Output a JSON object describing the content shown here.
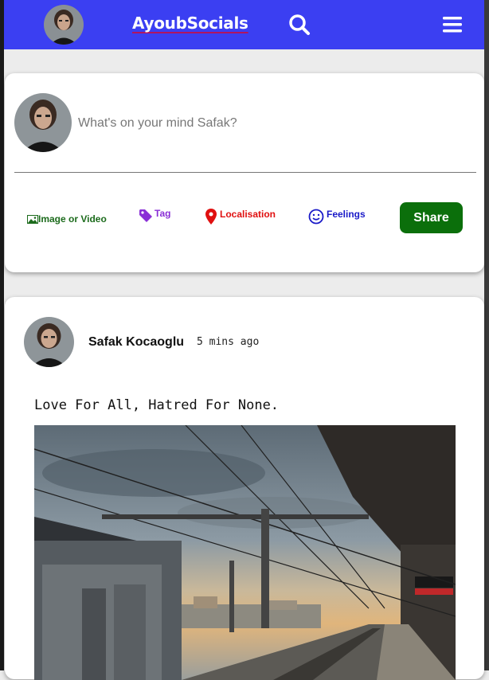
{
  "navbar": {
    "brand": "AyoubSocials",
    "icons": [
      "avatar",
      "search-icon",
      "menu-icon"
    ]
  },
  "composer": {
    "placeholder": "What's on your mind Safak?",
    "actions": {
      "image_video": "Image or Video",
      "tag": "Tag",
      "localisation": "Localisation",
      "feelings": "Feelings"
    },
    "share_label": "Share"
  },
  "post": {
    "author": "Safak Kocaoglu",
    "time": "5 mins ago",
    "text": "Love For All, Hatred For None."
  },
  "colors": {
    "navbar": "#3b3ff2",
    "share_button": "#0b6f0b",
    "image_action": "#1c6b1c",
    "tag_action": "#8a2fd6",
    "location_action": "#e01010",
    "feelings_action": "#1a1ac8"
  }
}
